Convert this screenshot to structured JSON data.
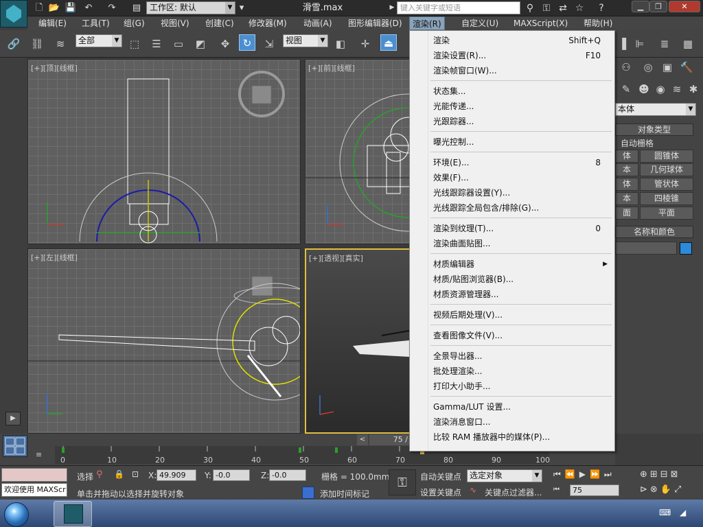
{
  "title_bar": {
    "file_name": "滑雪.max",
    "workspace_label": "工作区: 默认",
    "search_placeholder": "键入关键字或短语"
  },
  "menu_bar": {
    "items": [
      "编辑(E)",
      "工具(T)",
      "组(G)",
      "视图(V)",
      "创建(C)",
      "修改器(M)",
      "动画(A)",
      "图形编辑器(D)",
      "渲染(R)",
      "自定义(U)",
      "MAXScript(X)",
      "帮助(H)"
    ],
    "active": "渲染(R)"
  },
  "toolbar": {
    "selection_filter": "全部",
    "reference_coord": "视图"
  },
  "viewports": [
    {
      "label": "[+][顶][线框]"
    },
    {
      "label": "[+][前][线框]"
    },
    {
      "label": "[+][左][线框]"
    },
    {
      "label": "[+][透视][真实]"
    }
  ],
  "render_menu": {
    "items": [
      {
        "label": "渲染",
        "shortcut": "Shift+Q"
      },
      {
        "label": "渲染设置(R)...",
        "shortcut": "F10"
      },
      {
        "label": "渲染帧窗口(W)...",
        "shortcut": ""
      },
      {
        "label": "状态集...",
        "shortcut": ""
      },
      {
        "label": "光能传递...",
        "shortcut": ""
      },
      {
        "label": "光跟踪器...",
        "shortcut": ""
      },
      {
        "label": "曝光控制...",
        "shortcut": ""
      },
      {
        "label": "环境(E)...",
        "shortcut": "8"
      },
      {
        "label": "效果(F)...",
        "shortcut": ""
      },
      {
        "label": "光线跟踪器设置(Y)...",
        "shortcut": ""
      },
      {
        "label": "光线跟踪全局包含/排除(G)...",
        "shortcut": ""
      },
      {
        "label": "渲染到纹理(T)...",
        "shortcut": "0"
      },
      {
        "label": "渲染曲面贴图...",
        "shortcut": ""
      },
      {
        "label": "材质编辑器",
        "shortcut": ""
      },
      {
        "label": "材质/贴图浏览器(B)...",
        "shortcut": ""
      },
      {
        "label": "材质资源管理器...",
        "shortcut": ""
      },
      {
        "label": "视频后期处理(V)...",
        "shortcut": ""
      },
      {
        "label": "查看图像文件(V)...",
        "shortcut": ""
      },
      {
        "label": "全景导出器...",
        "shortcut": ""
      },
      {
        "label": "批处理渲染...",
        "shortcut": ""
      },
      {
        "label": "打印大小助手...",
        "shortcut": ""
      },
      {
        "label": "Gamma/LUT 设置...",
        "shortcut": ""
      },
      {
        "label": "渲染消息窗口...",
        "shortcut": ""
      },
      {
        "label": "比较 RAM 播放器中的媒体(P)...",
        "shortcut": ""
      }
    ]
  },
  "command_panel": {
    "category": "本体",
    "object_type": "对象类型",
    "auto_grid": "自动栅格",
    "buttons": [
      "体",
      "圆锥体",
      "本",
      "几何球体",
      "体",
      "管状体",
      "本",
      "四棱锥",
      "面",
      "平面"
    ],
    "name_color": "名称和颜色"
  },
  "timeline": {
    "frame_display": "75 /",
    "ticks": [
      "0",
      "10",
      "20",
      "30",
      "40",
      "50",
      "60",
      "70",
      "80",
      "90",
      "100"
    ]
  },
  "status_bar": {
    "maxscript": "欢迎使用 MAXScr",
    "select_label": "选择",
    "x_label": "X:",
    "x_value": "49.909",
    "y_label": "Y:",
    "y_value": "-0.0",
    "z_label": "Z:",
    "z_value": "-0.0",
    "grid": "栅格 = 100.0mm",
    "prompt": "单击并拖动以选择并旋转对象",
    "add_time_tag": "添加时间标记",
    "auto_key": "自动关键点",
    "set_key": "设置关键点",
    "selected_object": "选定对象",
    "key_filters": "关键点过滤器...",
    "current_frame": "75"
  }
}
